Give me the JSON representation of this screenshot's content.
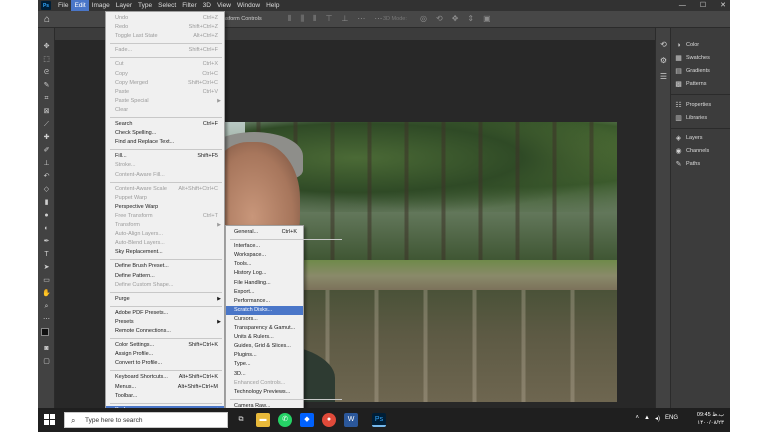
{
  "menubar": {
    "logo": "Ps",
    "menus": [
      "File",
      "Edit",
      "Image",
      "Layer",
      "Type",
      "Select",
      "Filter",
      "3D",
      "View",
      "Window",
      "Help"
    ],
    "active_menu": "Edit",
    "window_controls": [
      "—",
      "☐",
      "✕"
    ]
  },
  "options_bar": {
    "label": "ransform Controls",
    "mode_label": "3D Mode:"
  },
  "edit_menu": {
    "items": [
      {
        "label": "Undo",
        "shortcut": "Ctrl+Z",
        "disabled": true
      },
      {
        "label": "Redo",
        "shortcut": "Shift+Ctrl+Z",
        "disabled": true
      },
      {
        "label": "Toggle Last State",
        "shortcut": "Alt+Ctrl+Z",
        "disabled": true
      },
      {
        "sep": true
      },
      {
        "label": "Fade...",
        "shortcut": "Shift+Ctrl+F",
        "disabled": true
      },
      {
        "sep": true
      },
      {
        "label": "Cut",
        "shortcut": "Ctrl+X",
        "disabled": true
      },
      {
        "label": "Copy",
        "shortcut": "Ctrl+C",
        "disabled": true
      },
      {
        "label": "Copy Merged",
        "shortcut": "Shift+Ctrl+C",
        "disabled": true
      },
      {
        "label": "Paste",
        "shortcut": "Ctrl+V",
        "disabled": true
      },
      {
        "label": "Paste Special",
        "submenu": true,
        "disabled": true
      },
      {
        "label": "Clear",
        "disabled": true
      },
      {
        "sep": true
      },
      {
        "label": "Search",
        "shortcut": "Ctrl+F"
      },
      {
        "label": "Check Spelling..."
      },
      {
        "label": "Find and Replace Text..."
      },
      {
        "sep": true
      },
      {
        "label": "Fill...",
        "shortcut": "Shift+F5"
      },
      {
        "label": "Stroke...",
        "disabled": true
      },
      {
        "label": "Content-Aware Fill...",
        "disabled": true
      },
      {
        "sep": true
      },
      {
        "label": "Content-Aware Scale",
        "shortcut": "Alt+Shift+Ctrl+C",
        "disabled": true
      },
      {
        "label": "Puppet Warp",
        "disabled": true
      },
      {
        "label": "Perspective Warp"
      },
      {
        "label": "Free Transform",
        "shortcut": "Ctrl+T",
        "disabled": true
      },
      {
        "label": "Transform",
        "submenu": true,
        "disabled": true
      },
      {
        "label": "Auto-Align Layers...",
        "disabled": true
      },
      {
        "label": "Auto-Blend Layers...",
        "disabled": true
      },
      {
        "label": "Sky Replacement..."
      },
      {
        "sep": true
      },
      {
        "label": "Define Brush Preset..."
      },
      {
        "label": "Define Pattern..."
      },
      {
        "label": "Define Custom Shape...",
        "disabled": true
      },
      {
        "sep": true
      },
      {
        "label": "Purge",
        "submenu": true
      },
      {
        "sep": true
      },
      {
        "label": "Adobe PDF Presets..."
      },
      {
        "label": "Presets",
        "submenu": true
      },
      {
        "label": "Remote Connections..."
      },
      {
        "sep": true
      },
      {
        "label": "Color Settings...",
        "shortcut": "Shift+Ctrl+K"
      },
      {
        "label": "Assign Profile..."
      },
      {
        "label": "Convert to Profile..."
      },
      {
        "sep": true
      },
      {
        "label": "Keyboard Shortcuts...",
        "shortcut": "Alt+Shift+Ctrl+K"
      },
      {
        "label": "Menus...",
        "shortcut": "Alt+Shift+Ctrl+M"
      },
      {
        "label": "Toolbar..."
      },
      {
        "sep": true
      },
      {
        "label": "Preferences",
        "submenu": true,
        "highlighted": true
      }
    ]
  },
  "preferences_submenu": {
    "items": [
      {
        "label": "General...",
        "shortcut": "Ctrl+K"
      },
      {
        "sep": true
      },
      {
        "label": "Interface..."
      },
      {
        "label": "Workspace..."
      },
      {
        "label": "Tools..."
      },
      {
        "label": "History Log..."
      },
      {
        "label": "File Handling..."
      },
      {
        "label": "Export..."
      },
      {
        "label": "Performance..."
      },
      {
        "label": "Scratch Disks...",
        "highlighted": true
      },
      {
        "label": "Cursors..."
      },
      {
        "label": "Transparency & Gamut..."
      },
      {
        "label": "Units & Rulers..."
      },
      {
        "label": "Guides, Grid & Slices..."
      },
      {
        "label": "Plugins..."
      },
      {
        "label": "Type..."
      },
      {
        "label": "3D..."
      },
      {
        "label": "Enhanced Controls...",
        "disabled": true
      },
      {
        "label": "Technology Previews..."
      },
      {
        "sep": true
      },
      {
        "label": "Camera Raw..."
      }
    ]
  },
  "panels": {
    "groups": [
      [
        "Color",
        "Swatches",
        "Gradients",
        "Patterns"
      ],
      [
        "Properties",
        "Libraries"
      ],
      [
        "Layers",
        "Channels",
        "Paths"
      ]
    ]
  },
  "taskbar": {
    "search_placeholder": "Type here to search",
    "time": "09:45 ب.ظ",
    "date": "۱۴۰۰/۰۸/۲۳",
    "tray_text": "ENG"
  },
  "colors": {
    "menu_highlight": "#4a76c8",
    "app_bg": "#535353",
    "canvas_bg": "#282828"
  }
}
